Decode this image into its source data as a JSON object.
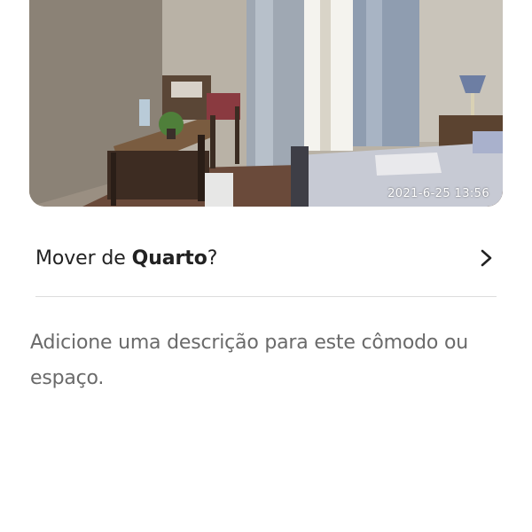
{
  "photo": {
    "timestamp": "2021-6-25 13:56"
  },
  "move_row": {
    "prefix": "Mover de ",
    "room_name": "Quarto",
    "suffix": "?",
    "icon": "chevron-right-icon"
  },
  "description": {
    "placeholder": "Adicione uma descrição para este cômodo ou espaço."
  },
  "colors": {
    "text_primary": "#222222",
    "text_secondary": "#6a6a6a",
    "divider": "#dddddd"
  }
}
